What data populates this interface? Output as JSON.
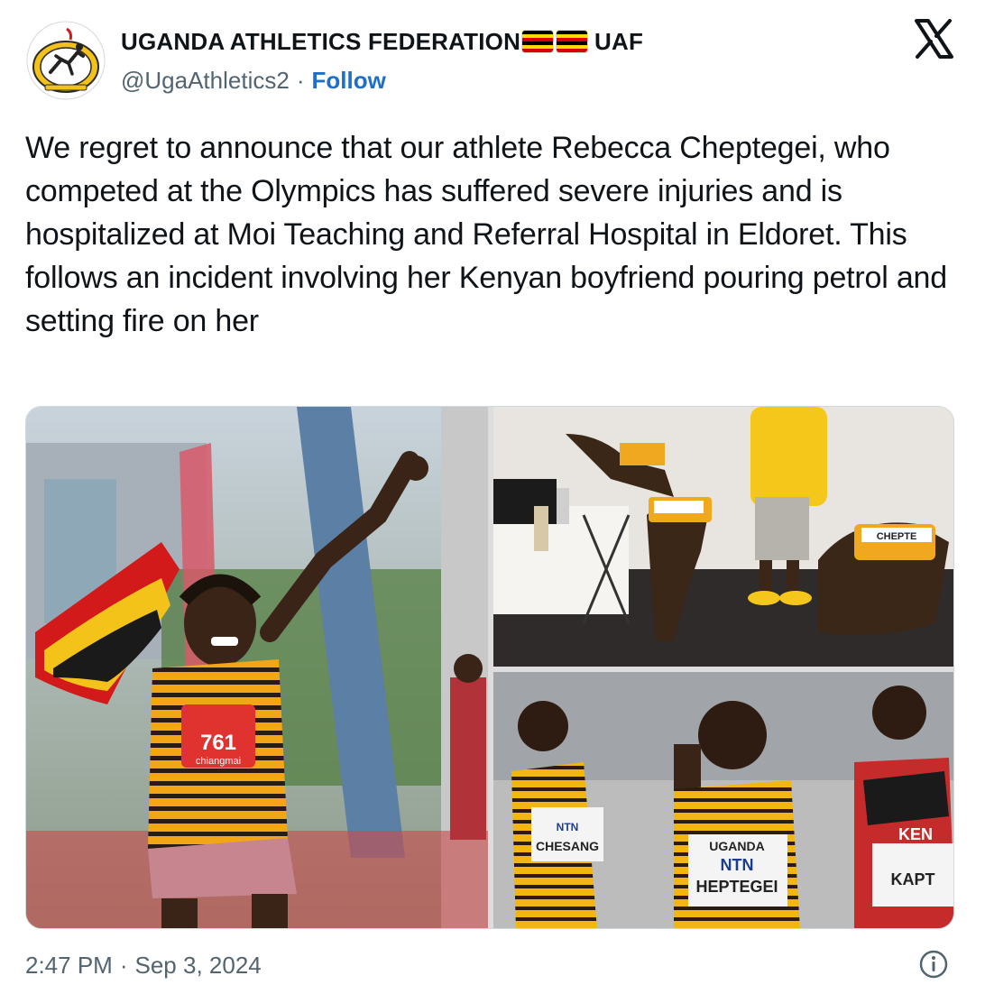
{
  "account": {
    "display_name": "UGANDA ATHLETICS FEDERATION",
    "name_suffix": "UAF",
    "handle": "@UgaAthletics2",
    "separator": "·",
    "follow_label": "Follow",
    "avatar_icon": "uaf-logo",
    "flag_icon": "uganda-flag"
  },
  "tweet": {
    "text": "We regret to announce that our athlete Rebecca Cheptegei, who competed at the Olympics has suffered severe injuries and is hospitalized at Moi Teaching and Referral Hospital in Eldoret. This follows an incident involving her Kenyan boyfriend pouring petrol and setting fire on her"
  },
  "media": {
    "photos": [
      {
        "name": "runner-celebrating-with-flag",
        "bib_number": "761",
        "bib_sponsor": "chiangmai"
      },
      {
        "name": "athletes-stretching-in-room",
        "bib_text": "CHEPTE"
      },
      {
        "name": "athletes-racing",
        "bibs": [
          "CHESANG",
          "UGANDA",
          "NTN",
          "HEPTEGEI",
          "KEN",
          "KAPT",
          "NTN"
        ]
      }
    ]
  },
  "footer": {
    "time": "2:47 PM",
    "separator": "·",
    "date": "Sep 3, 2024",
    "info_icon": "info-icon"
  },
  "colors": {
    "follow": "#1d6fc9",
    "secondary_text": "#536471",
    "flag_black": "#000000",
    "flag_yellow": "#fcdc04",
    "flag_red": "#d90000"
  }
}
